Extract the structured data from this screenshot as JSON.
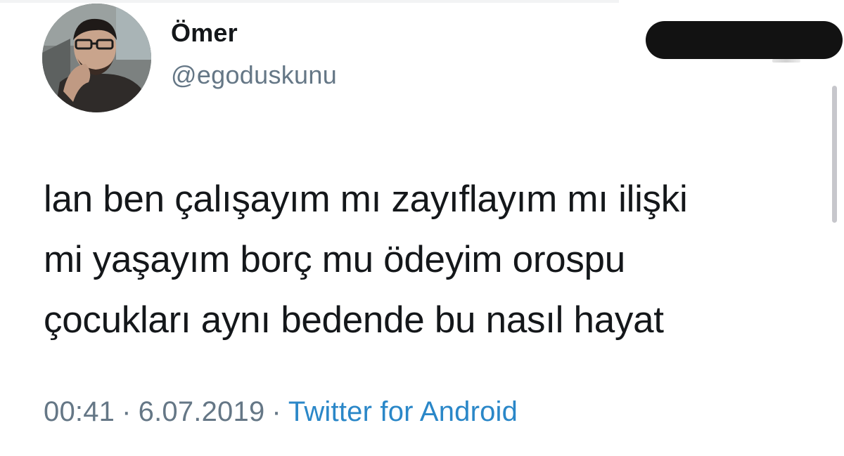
{
  "author": {
    "display_name": "Ömer",
    "username": "@egoduskunu",
    "avatar_icon": "profile-photo"
  },
  "tweet": {
    "text_lines": [
      "lan ben çalışayım mı zayıflayım mı ilişki",
      "mi yaşayım borç mu ödeyim orospu",
      "çocukları aynı bedende bu nasıl hayat"
    ]
  },
  "meta": {
    "time": "00:41",
    "separator": "·",
    "date": "6.07.2019",
    "source": "Twitter for Android"
  },
  "colors": {
    "text": "#14171a",
    "secondary": "#657786",
    "link": "#2a87c8",
    "redaction": "#121212"
  }
}
